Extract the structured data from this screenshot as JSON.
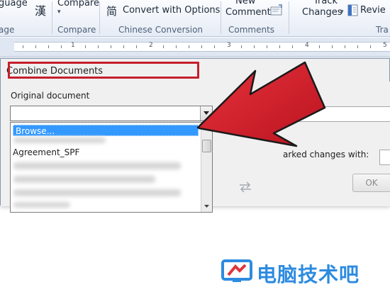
{
  "ribbon": {
    "language_label": "guage",
    "language_group": "age",
    "trad_char": "漢",
    "compare_button": "Compare",
    "compare_group": "Compare",
    "convert_options": "Convert with Options",
    "simp_char": "简",
    "chinese_group": "Chinese Conversion",
    "new_comment_line1": "New",
    "new_comment_line2": "Comment",
    "comments_group": "Comments",
    "track_line1": "Track",
    "track_line2": "Changes",
    "tracking_group": "Tra",
    "review_label": "Revie"
  },
  "ruler": {
    "numbers": [
      "1",
      "2",
      "3",
      "4",
      "5"
    ]
  },
  "dialog": {
    "title": "Combine Documents",
    "original_label": "Original document",
    "revised_label_partial": "d",
    "list_items": {
      "browse": "Browse...",
      "agreement": "Agreement_SPF"
    },
    "marked_changes_label": "arked changes with:",
    "ok_label": "OK"
  },
  "watermark": {
    "text": "电脑技术吧"
  },
  "colors": {
    "highlight_red": "#c51f2c",
    "arrow_red": "#d9202c",
    "selection_blue": "#3399ff",
    "watermark_blue": "#2d8be0"
  }
}
